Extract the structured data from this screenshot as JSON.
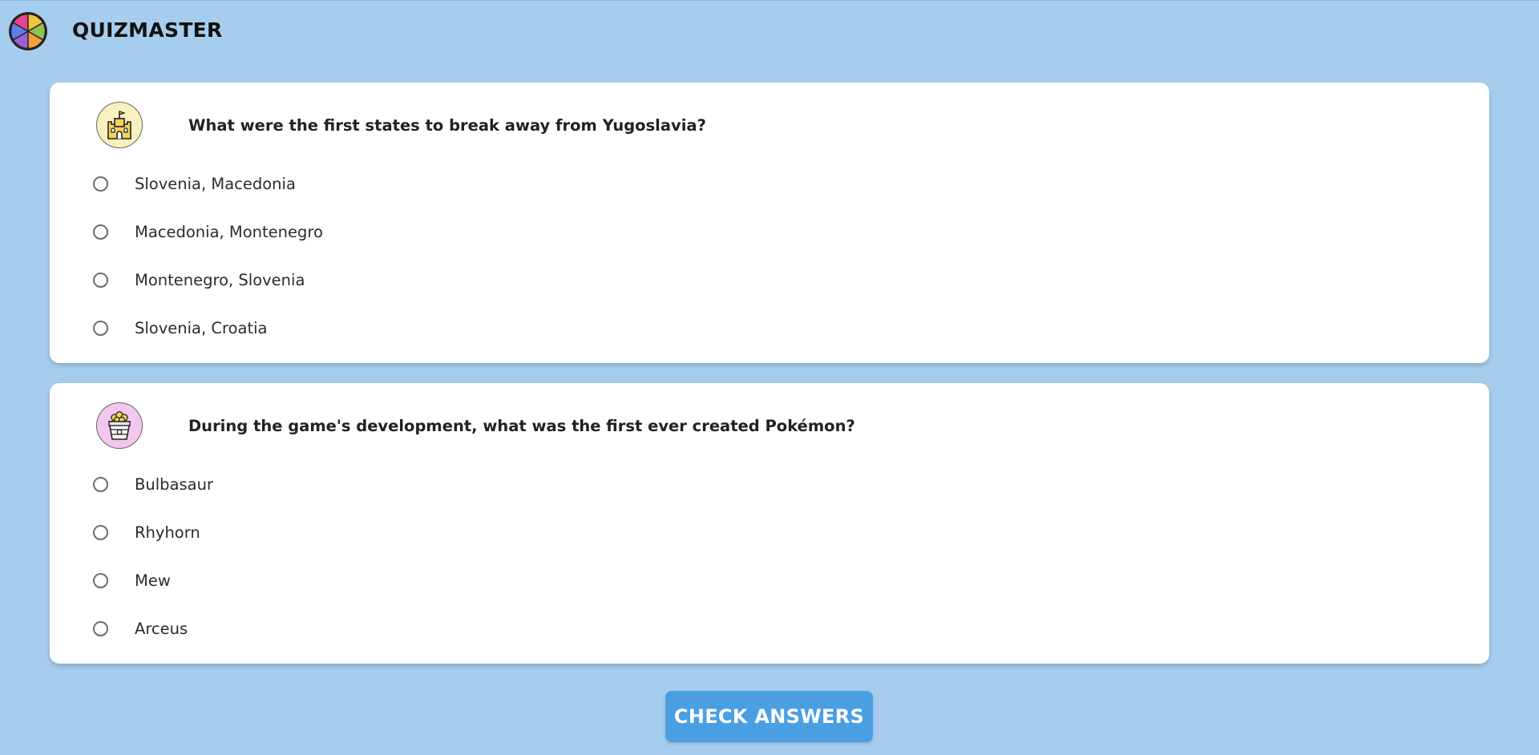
{
  "app": {
    "title": "QUIZMASTER",
    "logo_icon": "pie-wheel-icon",
    "logo_colors": [
      "#e8418f",
      "#f3c53a",
      "#8fc253",
      "#f2a03c",
      "#9a5fd0",
      "#5fb8e8"
    ]
  },
  "questions": [
    {
      "icon": "castle-icon",
      "icon_bg": "#f6f1bf",
      "text": "What were the first states to break away from Yugoslavia?",
      "options": [
        "Slovenia, Macedonia",
        "Macedonia, Montenegro",
        "Montenegro, Slovenia",
        "Slovenia, Croatia"
      ]
    },
    {
      "icon": "popcorn-icon",
      "icon_bg": "#f2c7ee",
      "text": "During the game's development, what was the first ever created Pokémon?",
      "options": [
        "Bulbasaur",
        "Rhyhorn",
        "Mew",
        "Arceus"
      ]
    }
  ],
  "actions": {
    "check_label": "CHECK ANSWERS",
    "button_color": "#4a9fe3"
  },
  "colors": {
    "background": "#a6cdee",
    "card": "#ffffff"
  }
}
